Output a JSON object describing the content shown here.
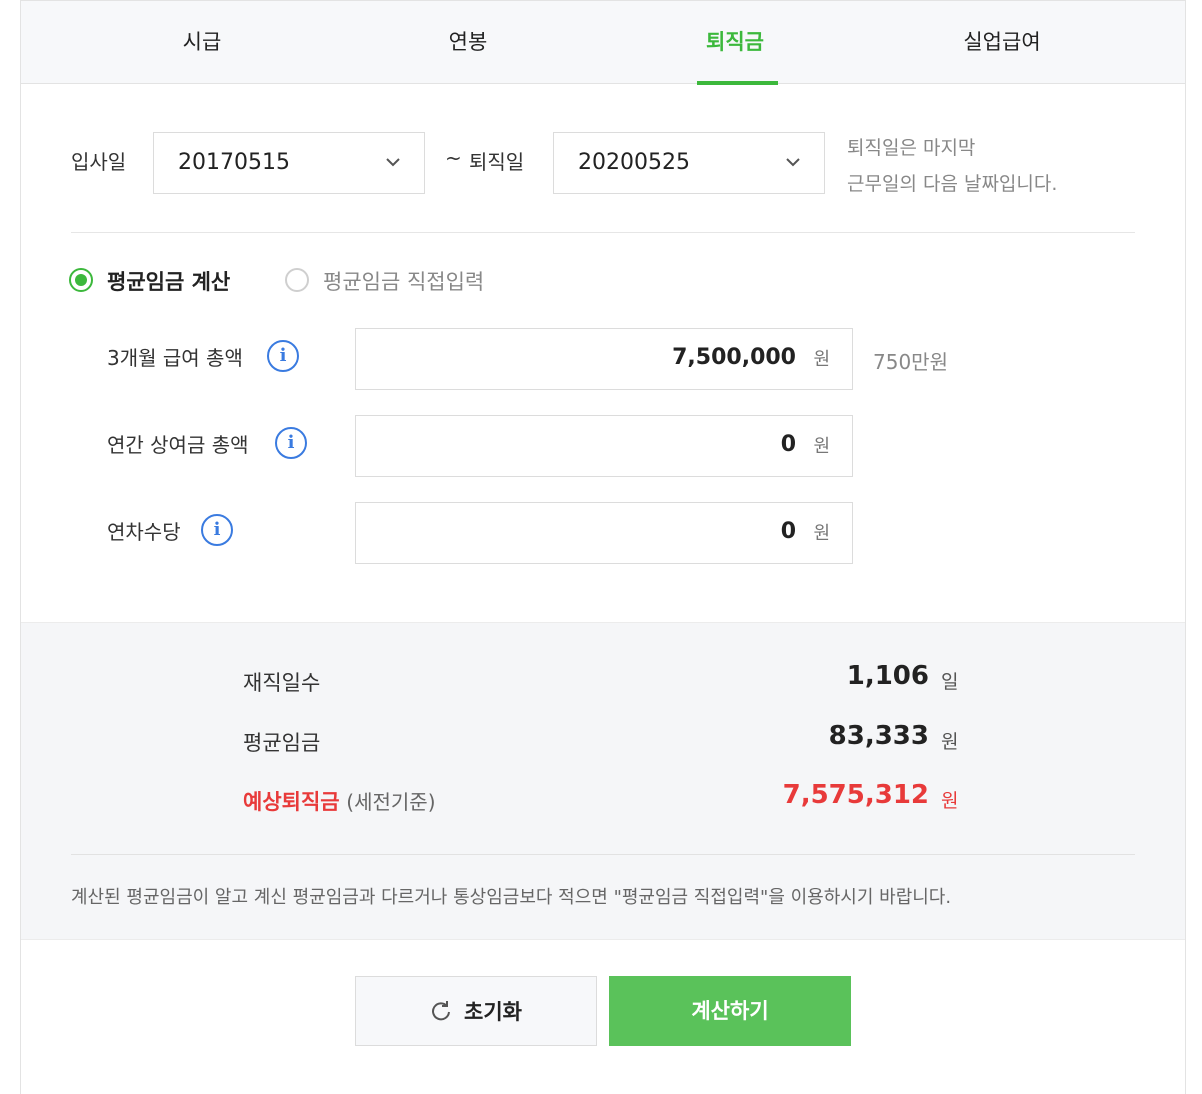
{
  "tabs": [
    {
      "label": "시급",
      "active": false
    },
    {
      "label": "연봉",
      "active": false
    },
    {
      "label": "퇴직금",
      "active": true
    },
    {
      "label": "실업급여",
      "active": false
    }
  ],
  "accent_color": "#3cb83c",
  "dates": {
    "join_label": "입사일",
    "join_value": "20170515",
    "separator": "~",
    "leave_label": "퇴직일",
    "leave_value": "20200525",
    "note_line1": "퇴직일은 마지막",
    "note_line2": "근무일의 다음 날짜입니다."
  },
  "mode": {
    "option1": "평균임금 계산",
    "option2": "평균임금 직접입력",
    "selected": "option1"
  },
  "inputs": [
    {
      "label": "3개월 급여 총액",
      "value": "7,500,000",
      "unit": "원",
      "hint": "750만원"
    },
    {
      "label": "연간 상여금 총액",
      "value": "0",
      "unit": "원",
      "hint": ""
    },
    {
      "label": "연차수당",
      "value": "0",
      "unit": "원",
      "hint": ""
    }
  ],
  "result": {
    "days_label": "재직일수",
    "days_value": "1,106",
    "days_unit": "일",
    "avg_label": "평균임금",
    "avg_value": "83,333",
    "avg_unit": "원",
    "sev_label": "예상퇴직금",
    "sev_sub": "(세전기준)",
    "sev_value": "7,575,312",
    "sev_unit": "원",
    "footnote": "계산된 평균임금이 알고 계신 평균임금과 다르거나 통상임금보다 적으면 \"평균임금 직접입력\"을 이용하시기 바랍니다."
  },
  "buttons": {
    "reset": "초기화",
    "calculate": "계산하기"
  },
  "icons": {
    "info": "i",
    "chevron": "chevron-down-icon",
    "refresh": "refresh-icon"
  }
}
